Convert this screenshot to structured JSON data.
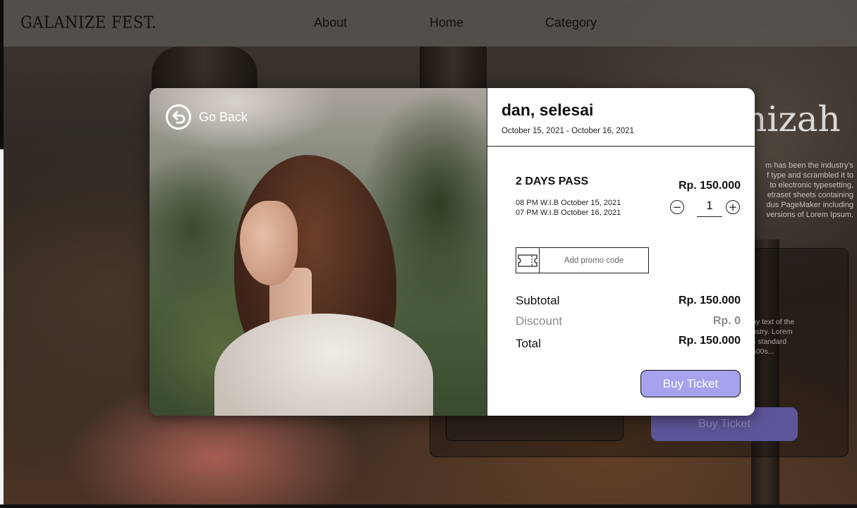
{
  "navbar": {
    "brand": "GALANIZE FEST.",
    "links": [
      "About",
      "Home",
      "Category"
    ]
  },
  "background": {
    "title_partial": "mizah",
    "description_lines": [
      "m has been the industry's",
      "f type and scrambled it to",
      "to electronic typesetting,",
      "etraset sheets containing",
      "dus PageMaker including",
      "versions of Lorem Ipsum."
    ],
    "card_text_lines": [
      "ny text of the",
      "ustry. Lorem",
      "s standard",
      "500s..."
    ],
    "buy_label": "Buy Ticket",
    "button_color": "#5c5598"
  },
  "modal": {
    "go_back_label": "Go Back",
    "event_name": "dan, selesai",
    "event_dates": "October 15, 2021 - October 16, 2021",
    "ticket": {
      "name": "2 DAYS PASS",
      "times": [
        "08 PM W.I.B October 15, 2021",
        "07 PM W.I.B October 16, 2021"
      ],
      "price": "Rp. 150.000",
      "quantity": "1",
      "decrement_symbol": "−",
      "increment_symbol": "+"
    },
    "promo": {
      "placeholder": "Add promo code",
      "value": "",
      "icon": "ticket-icon"
    },
    "summary": {
      "subtotal_label": "Subtotal",
      "subtotal_value": "Rp. 150.000",
      "discount_label": "Discount",
      "discount_value": "Rp. 0",
      "total_label": "Total",
      "total_value": "Rp. 150.000"
    },
    "buy_label": "Buy Ticket",
    "accent_color": "#a6a2ee"
  }
}
